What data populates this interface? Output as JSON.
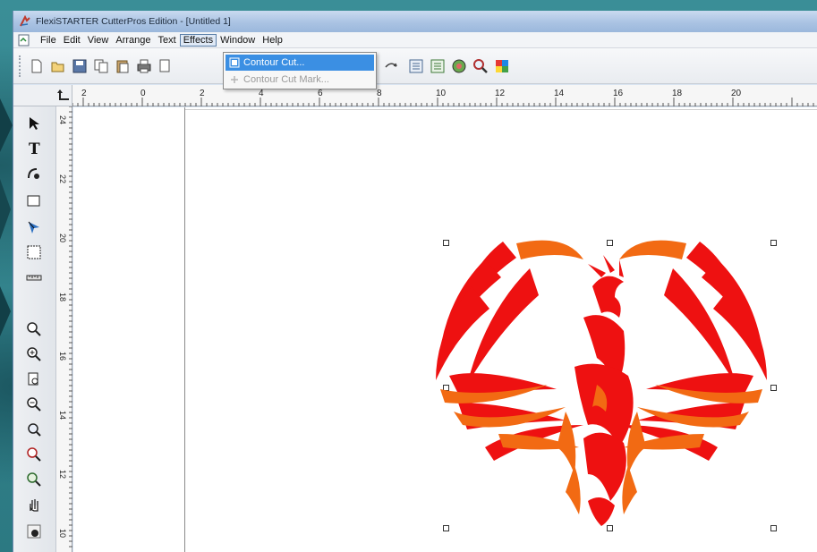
{
  "window": {
    "title": "FlexiSTARTER CutterPros Edition - [Untitled 1]"
  },
  "menubar": {
    "items": [
      "File",
      "Edit",
      "View",
      "Arrange",
      "Text",
      "Effects",
      "Window",
      "Help"
    ],
    "active": "Effects"
  },
  "effects_menu": {
    "items": [
      {
        "label": "Contour Cut...",
        "state": "highlighted"
      },
      {
        "label": "Contour Cut Mark...",
        "state": "disabled"
      }
    ]
  },
  "toolbar": {
    "buttons": [
      "new-icon",
      "open-icon",
      "save-icon",
      "copy-icon",
      "paste-icon",
      "print-icon",
      "print-preview-icon",
      "undo-icon",
      "redo-icon",
      "import-icon",
      "export-icon",
      "color-wheel-icon",
      "zoom-tool-icon",
      "color-palette-icon"
    ]
  },
  "toolbox": {
    "tools": [
      "pick-tool-icon",
      "text-tool-icon",
      "shape-edit-icon",
      "rectangle-tool-icon",
      "node-edit-icon",
      "select-frame-icon",
      "measure-icon",
      "zoom-icon",
      "zoom-in-icon",
      "zoom-page-icon",
      "zoom-out-icon",
      "zoom-fit-icon",
      "zoom-selection-icon",
      "zoom-all-icon",
      "pan-hand-icon",
      "fill-icon"
    ]
  },
  "rulers": {
    "horizontal_labels": [
      "2",
      "0",
      "2",
      "4",
      "6",
      "8",
      "10",
      "12",
      "14",
      "16",
      "18",
      "20"
    ],
    "vertical_labels": [
      "24",
      "22",
      "20",
      "18",
      "16",
      "14",
      "12",
      "10"
    ]
  },
  "artwork": {
    "name": "phoenix-graphic",
    "colors": {
      "primary": "#ee1111",
      "secondary": "#f26a13"
    }
  },
  "theme": {
    "highlight": "#3b8fe3",
    "titlebar": "#aac3e3",
    "backdrop": "#2f7f88"
  }
}
